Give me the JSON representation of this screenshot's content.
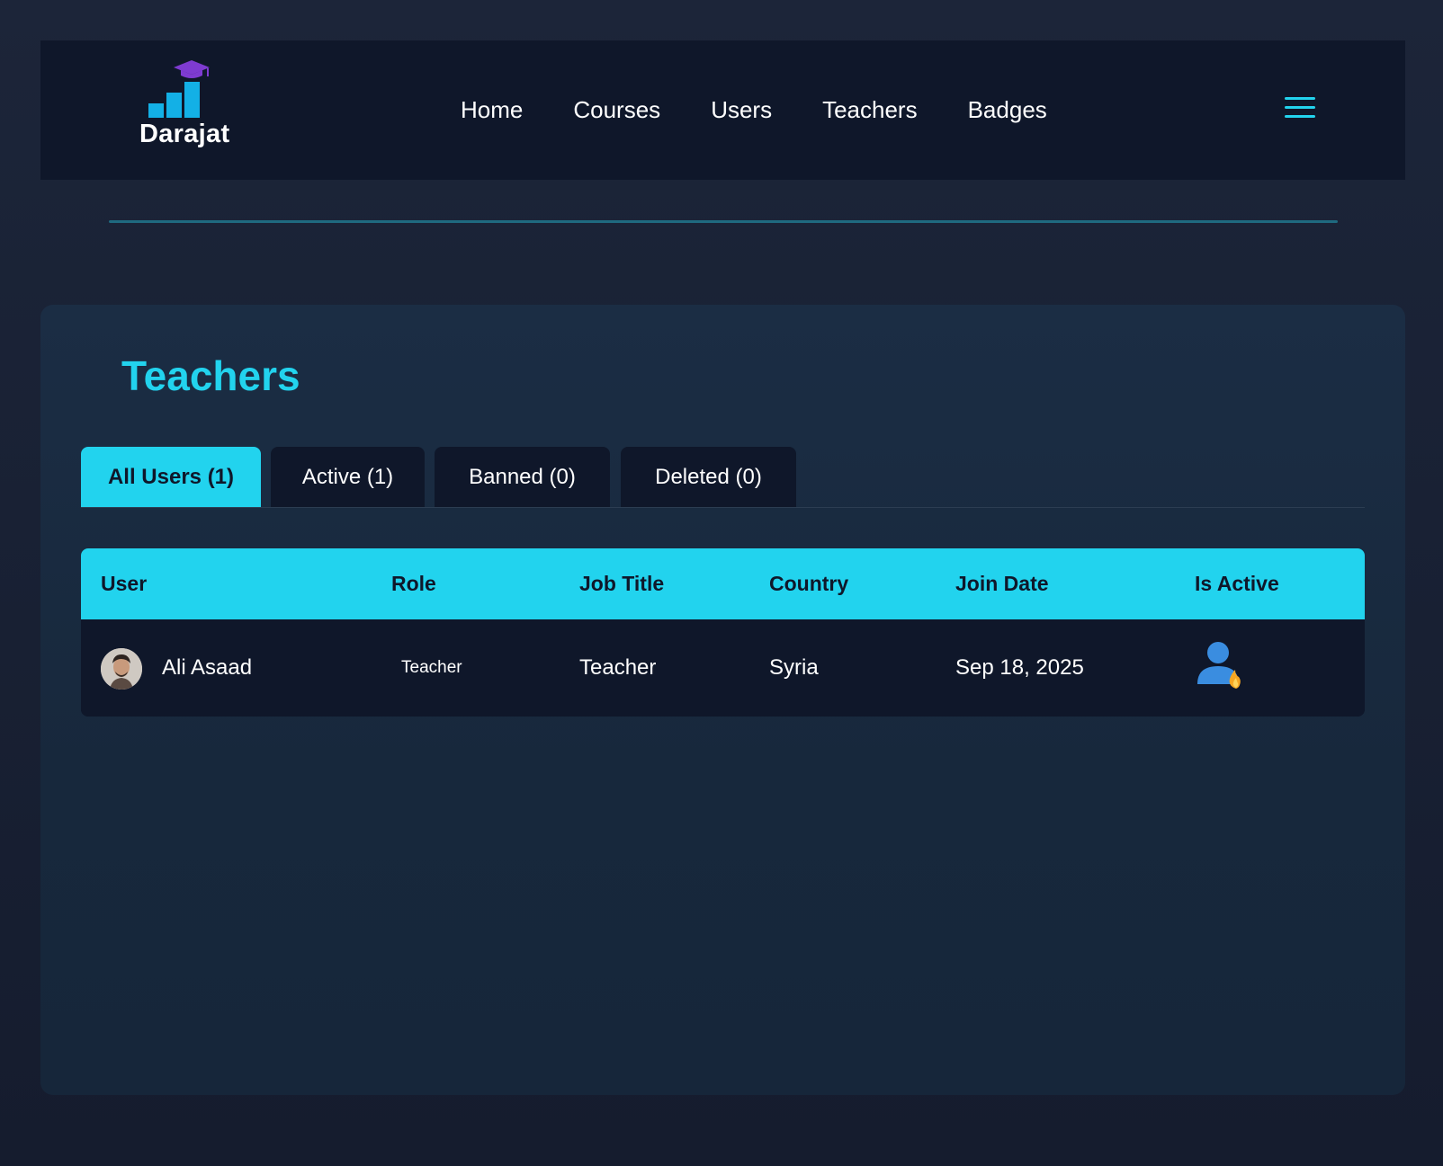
{
  "brand": {
    "name": "Darajat"
  },
  "nav": {
    "links": [
      "Home",
      "Courses",
      "Users",
      "Teachers",
      "Badges"
    ]
  },
  "page": {
    "title": "Teachers"
  },
  "tabs": [
    {
      "label": "All Users (1)",
      "active": true
    },
    {
      "label": "Active (1)",
      "active": false
    },
    {
      "label": "Banned (0)",
      "active": false
    },
    {
      "label": "Deleted (0)",
      "active": false
    }
  ],
  "table": {
    "headers": [
      "User",
      "Role",
      "Job Title",
      "Country",
      "Join Date",
      "Is Active"
    ],
    "rows": [
      {
        "user": "Ali Asaad",
        "role": "Teacher",
        "job_title": "Teacher",
        "country": "Syria",
        "join_date": "Sep 18, 2025",
        "is_active_icon": "active-user-icon"
      }
    ]
  },
  "colors": {
    "accent": "#22d3ee",
    "navbar_bg": "#0f172a",
    "logo_cap": "#7e3bd1",
    "logo_bars": "#13b0e6"
  }
}
